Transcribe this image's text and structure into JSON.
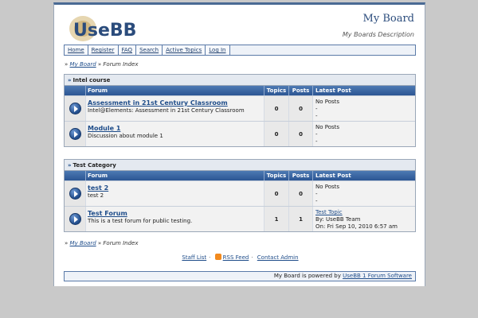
{
  "header": {
    "logo_text": "UseBB",
    "board_title": "My Board",
    "board_description": "My Boards Description"
  },
  "nav": [
    "Home",
    "Register",
    "FAQ",
    "Search",
    "Active Topics",
    "Log In"
  ],
  "breadcrumb": {
    "board": "My Board",
    "separator": "»",
    "current": "Forum Index"
  },
  "columns": {
    "forum": "Forum",
    "topics": "Topics",
    "posts": "Posts",
    "last_post": "Latest Post"
  },
  "categories": [
    {
      "title": "Intel course",
      "forums": [
        {
          "name": "Assessment in 21st Century Classroom",
          "description": "Intel@Elements: Assessment in 21st Century Classroom",
          "topics": "0",
          "posts": "0",
          "last_post": [
            "No Posts",
            "-",
            "-"
          ]
        },
        {
          "name": "Module 1",
          "description": "Discussion about module 1",
          "topics": "0",
          "posts": "0",
          "last_post": [
            "No Posts",
            "-",
            "-"
          ]
        }
      ]
    },
    {
      "title": "Test Category",
      "forums": [
        {
          "name": "test 2",
          "description": "test 2",
          "topics": "0",
          "posts": "0",
          "last_post": [
            "No Posts",
            "-",
            "-"
          ]
        },
        {
          "name": "Test Forum",
          "description": "This is a test forum for public testing.",
          "topics": "1",
          "posts": "1",
          "last_post": [
            "Test Topic",
            "By: UseBB Team",
            "On: Fri Sep 10, 2010 6:57 am"
          ]
        }
      ]
    }
  ],
  "links": {
    "staff": "Staff List",
    "rss": "RSS Feed",
    "contact": "Contact Admin",
    "dot": "·"
  },
  "footer": {
    "prefix": "My Board is powered by",
    "link": "UseBB 1 Forum Software"
  },
  "colors": {
    "accent": "#2c5593",
    "link": "#1f4d8a",
    "rss": "#f28a1e"
  }
}
